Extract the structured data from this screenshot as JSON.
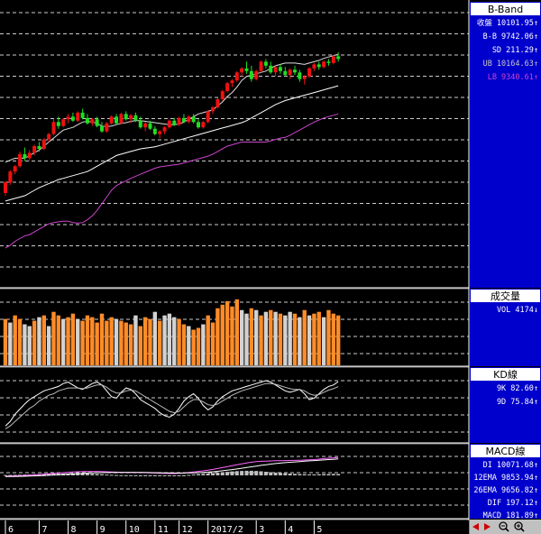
{
  "panels": {
    "bband": {
      "title": "B-Band",
      "rows": [
        {
          "label": "收盤",
          "value": "10101.95",
          "arrow": "↑",
          "color": "#ffffff"
        },
        {
          "label": "B-B",
          "value": "9742.06",
          "arrow": "↑",
          "color": "#ffffff"
        },
        {
          "label": "SD",
          "value": "211.29",
          "arrow": "↑",
          "color": "#ffffff"
        },
        {
          "label": "UB",
          "value": "10164.63",
          "arrow": "↑",
          "color": "#c8c8c8"
        },
        {
          "label": "LB",
          "value": "9340.61",
          "arrow": "↑",
          "color": "#cc44cc"
        }
      ]
    },
    "volume": {
      "title": "成交量",
      "rows": [
        {
          "label": "VOL",
          "value": "4174",
          "arrow": "↓",
          "color": "#ffffff"
        }
      ]
    },
    "kd": {
      "title": "KD線",
      "rows": [
        {
          "label": "9K",
          "value": "82.60",
          "arrow": "↑",
          "color": "#ffffff"
        },
        {
          "label": "9D",
          "value": "75.84",
          "arrow": "↑",
          "color": "#ffffff"
        }
      ]
    },
    "macd": {
      "title": "MACD線",
      "rows": [
        {
          "label": "DI",
          "value": "10071.68",
          "arrow": "↑",
          "color": "#ffffff"
        },
        {
          "label": "12EMA",
          "value": "9853.94",
          "arrow": "↑",
          "color": "#ffffff"
        },
        {
          "label": "26EMA",
          "value": "9656.82",
          "arrow": "↑",
          "color": "#ffffff"
        },
        {
          "label": "DIF",
          "value": "197.12",
          "arrow": "↑",
          "color": "#ffffff"
        },
        {
          "label": "MACD",
          "value": "181.89",
          "arrow": "↑",
          "color": "#ffffff"
        }
      ]
    }
  },
  "x_axis_labels": [
    {
      "label": "6",
      "index": 0
    },
    {
      "label": "7",
      "index": 7
    },
    {
      "label": "8",
      "index": 13
    },
    {
      "label": "9",
      "index": 19
    },
    {
      "label": "10",
      "index": 25
    },
    {
      "label": "11",
      "index": 31
    },
    {
      "label": "12",
      "index": 36
    },
    {
      "label": "2017/2",
      "index": 42
    },
    {
      "label": "3",
      "index": 52
    },
    {
      "label": "4",
      "index": 58
    },
    {
      "label": "5",
      "index": 64
    }
  ],
  "colors": {
    "up": "#ee1111",
    "down": "#22dd22",
    "vol_up": "#ff8c28",
    "vol_down": "#d2d2d2",
    "ub_line": "#dddddd",
    "ma_line": "#ffffff",
    "lb_line": "#cc44cc",
    "grid": "#cccccc",
    "side_bg": "#0000cc",
    "side_head_bg": "#ffffff",
    "side_head_text": "#000000"
  },
  "toolbar": {
    "icons": [
      "scroll-left-icon",
      "scroll-right-icon",
      "zoom-out-icon",
      "zoom-in-icon"
    ]
  },
  "chart_data": {
    "type": "candlestick",
    "count": 70,
    "candles": [
      [
        8850,
        8940,
        8830,
        8930
      ],
      [
        8930,
        9020,
        8910,
        9010
      ],
      [
        9010,
        9060,
        8990,
        9050
      ],
      [
        9050,
        9160,
        9040,
        9140
      ],
      [
        9140,
        9190,
        9090,
        9110
      ],
      [
        9110,
        9170,
        9090,
        9150
      ],
      [
        9150,
        9210,
        9130,
        9200
      ],
      [
        9200,
        9230,
        9160,
        9180
      ],
      [
        9180,
        9260,
        9170,
        9250
      ],
      [
        9250,
        9300,
        9230,
        9290
      ],
      [
        9290,
        9400,
        9280,
        9380
      ],
      [
        9380,
        9420,
        9330,
        9350
      ],
      [
        9350,
        9410,
        9340,
        9400
      ],
      [
        9400,
        9440,
        9370,
        9420
      ],
      [
        9420,
        9450,
        9380,
        9390
      ],
      [
        9390,
        9460,
        9380,
        9450
      ],
      [
        9450,
        9480,
        9400,
        9410
      ],
      [
        9410,
        9440,
        9360,
        9370
      ],
      [
        9370,
        9410,
        9350,
        9400
      ],
      [
        9400,
        9420,
        9340,
        9350
      ],
      [
        9350,
        9380,
        9300,
        9310
      ],
      [
        9310,
        9380,
        9300,
        9370
      ],
      [
        9370,
        9430,
        9360,
        9420
      ],
      [
        9420,
        9440,
        9360,
        9370
      ],
      [
        9370,
        9450,
        9360,
        9440
      ],
      [
        9440,
        9460,
        9390,
        9400
      ],
      [
        9400,
        9440,
        9370,
        9430
      ],
      [
        9430,
        9450,
        9380,
        9390
      ],
      [
        9390,
        9420,
        9330,
        9340
      ],
      [
        9340,
        9380,
        9310,
        9370
      ],
      [
        9370,
        9390,
        9320,
        9330
      ],
      [
        9330,
        9350,
        9280,
        9290
      ],
      [
        9290,
        9320,
        9260,
        9310
      ],
      [
        9310,
        9350,
        9290,
        9340
      ],
      [
        9340,
        9400,
        9330,
        9390
      ],
      [
        9390,
        9410,
        9350,
        9360
      ],
      [
        9360,
        9420,
        9350,
        9410
      ],
      [
        9410,
        9440,
        9370,
        9380
      ],
      [
        9380,
        9430,
        9370,
        9420
      ],
      [
        9420,
        9440,
        9370,
        9380
      ],
      [
        9380,
        9400,
        9330,
        9340
      ],
      [
        9340,
        9390,
        9330,
        9380
      ],
      [
        9380,
        9470,
        9370,
        9460
      ],
      [
        9460,
        9500,
        9440,
        9490
      ],
      [
        9490,
        9560,
        9480,
        9550
      ],
      [
        9550,
        9620,
        9540,
        9610
      ],
      [
        9610,
        9680,
        9600,
        9670
      ],
      [
        9670,
        9700,
        9640,
        9690
      ],
      [
        9690,
        9760,
        9680,
        9750
      ],
      [
        9750,
        9790,
        9720,
        9780
      ],
      [
        9780,
        9830,
        9740,
        9760
      ],
      [
        9760,
        9800,
        9680,
        9700
      ],
      [
        9700,
        9770,
        9690,
        9760
      ],
      [
        9760,
        9840,
        9750,
        9830
      ],
      [
        9830,
        9850,
        9780,
        9800
      ],
      [
        9800,
        9830,
        9740,
        9750
      ],
      [
        9750,
        9800,
        9720,
        9790
      ],
      [
        9790,
        9810,
        9740,
        9760
      ],
      [
        9760,
        9790,
        9720,
        9730
      ],
      [
        9730,
        9780,
        9700,
        9770
      ],
      [
        9770,
        9800,
        9730,
        9750
      ],
      [
        9750,
        9770,
        9680,
        9700
      ],
      [
        9700,
        9730,
        9660,
        9720
      ],
      [
        9720,
        9790,
        9710,
        9780
      ],
      [
        9780,
        9820,
        9760,
        9810
      ],
      [
        9810,
        9830,
        9770,
        9790
      ],
      [
        9790,
        9840,
        9780,
        9830
      ],
      [
        9830,
        9850,
        9800,
        9820
      ],
      [
        9820,
        9880,
        9810,
        9870
      ],
      [
        9870,
        9900,
        9830,
        9850
      ]
    ],
    "ub": [
      9080,
      9095,
      9110,
      9110,
      9110,
      9130,
      9150,
      9170,
      9200,
      9230,
      9260,
      9290,
      9320,
      9330,
      9340,
      9360,
      9380,
      9385,
      9380,
      9370,
      9350,
      9345,
      9350,
      9360,
      9370,
      9375,
      9385,
      9390,
      9390,
      9385,
      9380,
      9375,
      9370,
      9365,
      9360,
      9360,
      9365,
      9380,
      9400,
      9420,
      9440,
      9450,
      9460,
      9470,
      9500,
      9530,
      9570,
      9600,
      9640,
      9690,
      9720,
      9730,
      9740,
      9750,
      9760,
      9780,
      9800,
      9810,
      9820,
      9820,
      9820,
      9815,
      9810,
      9820,
      9830,
      9840,
      9855,
      9865,
      9875,
      9885
    ],
    "ma": [
      8790,
      8800,
      8810,
      8820,
      8830,
      8850,
      8870,
      8890,
      8905,
      8920,
      8935,
      8950,
      8960,
      8970,
      8980,
      8990,
      9000,
      9010,
      9030,
      9050,
      9070,
      9090,
      9110,
      9130,
      9140,
      9150,
      9160,
      9170,
      9180,
      9185,
      9190,
      9195,
      9205,
      9215,
      9225,
      9235,
      9245,
      9255,
      9265,
      9275,
      9285,
      9295,
      9305,
      9315,
      9325,
      9335,
      9345,
      9355,
      9365,
      9375,
      9390,
      9410,
      9430,
      9450,
      9470,
      9490,
      9510,
      9525,
      9540,
      9550,
      9560,
      9570,
      9580,
      9590,
      9600,
      9610,
      9620,
      9630,
      9640,
      9650
    ],
    "lb": [
      8440,
      8460,
      8490,
      8510,
      8530,
      8540,
      8560,
      8580,
      8600,
      8620,
      8630,
      8635,
      8640,
      8640,
      8630,
      8625,
      8630,
      8650,
      8680,
      8720,
      8770,
      8820,
      8870,
      8905,
      8925,
      8940,
      8960,
      8975,
      8990,
      9005,
      9020,
      9035,
      9045,
      9050,
      9055,
      9060,
      9065,
      9075,
      9085,
      9095,
      9105,
      9115,
      9125,
      9140,
      9160,
      9180,
      9200,
      9210,
      9220,
      9230,
      9230,
      9230,
      9230,
      9230,
      9230,
      9240,
      9250,
      9260,
      9265,
      9280,
      9300,
      9320,
      9340,
      9360,
      9380,
      9395,
      9410,
      9420,
      9430,
      9440
    ],
    "volume": [
      [
        2600,
        true
      ],
      [
        2400,
        false
      ],
      [
        2800,
        true
      ],
      [
        2600,
        true
      ],
      [
        2300,
        false
      ],
      [
        2200,
        false
      ],
      [
        2500,
        true
      ],
      [
        2700,
        false
      ],
      [
        2800,
        true
      ],
      [
        2200,
        false
      ],
      [
        3000,
        true
      ],
      [
        2800,
        true
      ],
      [
        2600,
        false
      ],
      [
        2700,
        true
      ],
      [
        2900,
        true
      ],
      [
        2600,
        false
      ],
      [
        2500,
        true
      ],
      [
        2800,
        true
      ],
      [
        2700,
        true
      ],
      [
        2400,
        true
      ],
      [
        2900,
        true
      ],
      [
        2500,
        true
      ],
      [
        2700,
        true
      ],
      [
        2600,
        false
      ],
      [
        2500,
        true
      ],
      [
        2400,
        true
      ],
      [
        2300,
        true
      ],
      [
        2800,
        false
      ],
      [
        2200,
        true
      ],
      [
        2700,
        true
      ],
      [
        2600,
        true
      ],
      [
        3000,
        false
      ],
      [
        2500,
        true
      ],
      [
        2800,
        false
      ],
      [
        2900,
        false
      ],
      [
        2700,
        false
      ],
      [
        2600,
        true
      ],
      [
        2300,
        true
      ],
      [
        2200,
        false
      ],
      [
        2000,
        true
      ],
      [
        2100,
        true
      ],
      [
        2300,
        false
      ],
      [
        2800,
        true
      ],
      [
        2400,
        true
      ],
      [
        3200,
        true
      ],
      [
        3400,
        true
      ],
      [
        3600,
        true
      ],
      [
        3300,
        true
      ],
      [
        3700,
        true
      ],
      [
        3100,
        false
      ],
      [
        2900,
        false
      ],
      [
        3200,
        true
      ],
      [
        3100,
        false
      ],
      [
        2800,
        true
      ],
      [
        3000,
        false
      ],
      [
        3100,
        true
      ],
      [
        3000,
        false
      ],
      [
        2900,
        true
      ],
      [
        2800,
        false
      ],
      [
        3000,
        false
      ],
      [
        2900,
        true
      ],
      [
        2700,
        false
      ],
      [
        3100,
        true
      ],
      [
        2800,
        false
      ],
      [
        2900,
        true
      ],
      [
        3000,
        true
      ],
      [
        2700,
        false
      ],
      [
        3100,
        true
      ],
      [
        2900,
        true
      ],
      [
        2800,
        true
      ]
    ],
    "volume_max": 4200,
    "k": [
      22,
      28,
      38,
      45,
      52,
      58,
      62,
      66,
      70,
      72,
      74,
      76,
      80,
      82,
      78,
      74,
      72,
      76,
      80,
      82,
      78,
      70,
      62,
      60,
      68,
      74,
      72,
      66,
      58,
      54,
      50,
      46,
      40,
      36,
      34,
      38,
      46,
      56,
      62,
      66,
      60,
      50,
      44,
      48,
      56,
      62,
      66,
      70,
      72,
      74,
      76,
      78,
      80,
      82,
      84,
      82,
      78,
      74,
      70,
      68,
      70,
      72,
      66,
      58,
      60,
      66,
      72,
      76,
      78,
      82.6
    ],
    "d": [
      18,
      22,
      28,
      34,
      40,
      46,
      50,
      56,
      60,
      64,
      66,
      70,
      72,
      74,
      74,
      74,
      73,
      74,
      76,
      78,
      78,
      75,
      70,
      67,
      67,
      70,
      71,
      70,
      66,
      62,
      58,
      54,
      50,
      46,
      42,
      40,
      42,
      48,
      54,
      58,
      58,
      55,
      51,
      50,
      52,
      56,
      60,
      64,
      67,
      70,
      72,
      74,
      76,
      78,
      80,
      80,
      79,
      77,
      75,
      73,
      72,
      72,
      70,
      66,
      64,
      65,
      68,
      71,
      73,
      75.84
    ],
    "dif": [
      -10,
      -8,
      -6,
      -4,
      -1,
      2,
      6,
      10,
      14,
      18,
      22,
      26,
      30,
      34,
      38,
      40,
      42,
      44,
      44,
      44,
      42,
      40,
      38,
      36,
      34,
      34,
      34,
      33,
      32,
      30,
      28,
      26,
      24,
      22,
      20,
      20,
      22,
      26,
      32,
      38,
      44,
      50,
      58,
      66,
      76,
      86,
      96,
      108,
      118,
      128,
      138,
      146,
      152,
      156,
      158,
      160,
      162,
      163,
      164,
      165,
      166,
      168,
      170,
      172,
      175,
      180,
      186,
      190,
      194,
      197.12
    ],
    "macd": [
      -14,
      -13,
      -12,
      -11,
      -10,
      -8,
      -6,
      -4,
      -2,
      1,
      4,
      7,
      10,
      13,
      16,
      19,
      22,
      25,
      27,
      29,
      30,
      31,
      32,
      32,
      32,
      32,
      32,
      32,
      32,
      32,
      31,
      30,
      29,
      28,
      27,
      26,
      26,
      26,
      27,
      28,
      30,
      33,
      36,
      40,
      45,
      51,
      57,
      64,
      71,
      79,
      87,
      95,
      103,
      111,
      118,
      125,
      131,
      136,
      141,
      145,
      149,
      153,
      157,
      161,
      164,
      167,
      171,
      175,
      178,
      181.89
    ],
    "osc_scale": 240
  }
}
